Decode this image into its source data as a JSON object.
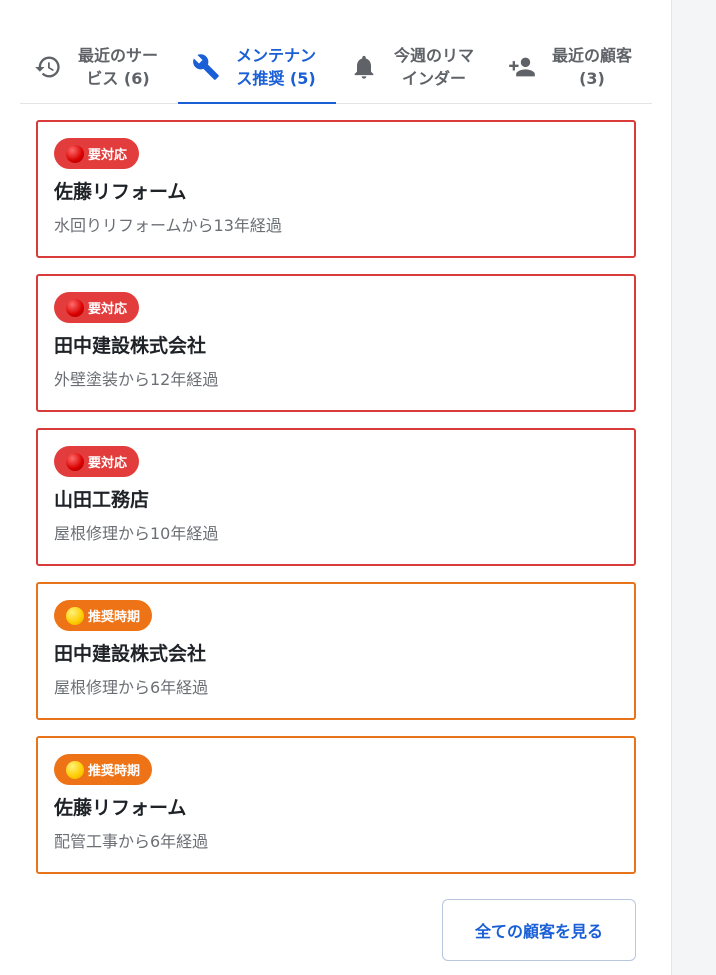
{
  "tabs": [
    {
      "icon": "history-icon",
      "label": "最近のサービス (6)",
      "active": false
    },
    {
      "icon": "wrench-icon",
      "label": "メンテナンス推奨 (5)",
      "active": true
    },
    {
      "icon": "bell-icon",
      "label": "今週のリマインダー",
      "active": false
    },
    {
      "icon": "person-add-icon",
      "label": "最近の顧客 (3)",
      "active": false
    }
  ],
  "cards": [
    {
      "badge": "要対応",
      "level": "urgent",
      "customer": "佐藤リフォーム",
      "description": "水回りリフォームから13年経過"
    },
    {
      "badge": "要対応",
      "level": "urgent",
      "customer": "田中建設株式会社",
      "description": "外壁塗装から12年経過"
    },
    {
      "badge": "要対応",
      "level": "urgent",
      "customer": "山田工務店",
      "description": "屋根修理から10年経過"
    },
    {
      "badge": "推奨時期",
      "level": "recommended",
      "customer": "田中建設株式会社",
      "description": "屋根修理から6年経過"
    },
    {
      "badge": "推奨時期",
      "level": "recommended",
      "customer": "佐藤リフォーム",
      "description": "配管工事から6年経過"
    }
  ],
  "footer": {
    "all_customers_button": "全ての顧客を見る"
  },
  "colors": {
    "accent": "#1a5fd6",
    "urgent": "#e23c3c",
    "recommended": "#ee7316"
  }
}
